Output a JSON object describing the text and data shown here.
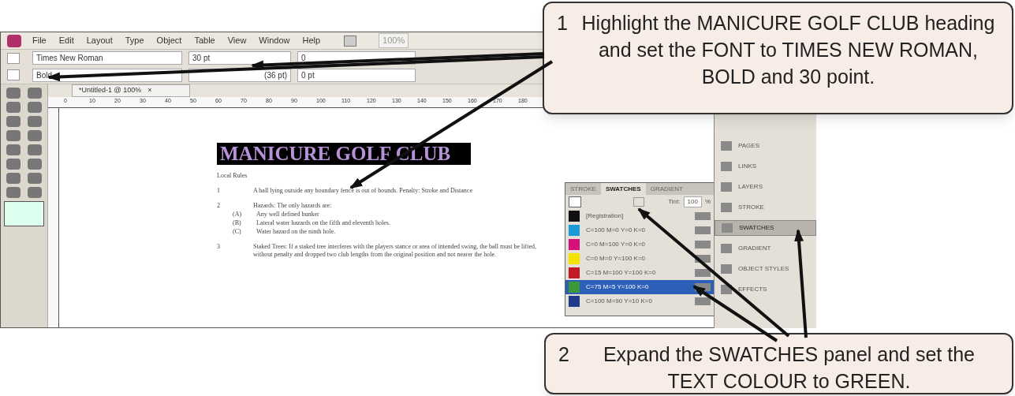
{
  "menu_bar": [
    "File",
    "Edit",
    "Layout",
    "Type",
    "Object",
    "Table",
    "View",
    "Window",
    "Help"
  ],
  "zoom_field": "100%",
  "control_bar": {
    "font_family": "Times New Roman",
    "font_style": "Bold",
    "font_size": "30 pt",
    "leading": "(36 pt)",
    "tracking": "0",
    "baseline": "0 pt"
  },
  "document_tab": {
    "label": "*Untitled-1 @ 100%",
    "close": "×"
  },
  "ruler_marks": [
    "0",
    "10",
    "20",
    "30",
    "40",
    "50",
    "60",
    "70",
    "80",
    "90",
    "100",
    "110",
    "120",
    "130",
    "140",
    "150",
    "160",
    "170",
    "180"
  ],
  "document": {
    "heading": "MANICURE GOLF CLUB",
    "paragraphs": [
      {
        "kind": "plain",
        "text": "Local Rules"
      },
      {
        "kind": "numbered",
        "number": "1",
        "text": "A ball lying outside any boundary fence is out of bounds.  Penalty: Stroke and Distance"
      },
      {
        "kind": "numbered",
        "number": "2",
        "text": "Hazards:  The only hazards are:"
      },
      {
        "kind": "sub",
        "number": "(A)",
        "text": "Any well defined bunker"
      },
      {
        "kind": "sub",
        "number": "(B)",
        "text": "Lateral water hazards on the fifth and eleventh holes."
      },
      {
        "kind": "sub",
        "number": "(C)",
        "text": "Water hazard on the ninth hole."
      },
      {
        "kind": "numbered",
        "number": "3",
        "text": "Staked Trees:  If a staked tree interferes with the players stance or area of intended swing, the ball must be lifted, without penalty and dropped two club lengths from the original position and not nearer the hole."
      }
    ]
  },
  "swatches_panel": {
    "tabs": [
      {
        "label": "STROKE",
        "selected": false
      },
      {
        "label": "SWATCHES",
        "selected": true
      },
      {
        "label": "GRADIENT",
        "selected": false
      }
    ],
    "tint_label": "Tint:",
    "tint_value": "100",
    "tint_unit": "%",
    "swatches": [
      {
        "name": "[Registration]",
        "color": "#111111",
        "selected": false
      },
      {
        "name": "C=100 M=0 Y=0 K=0",
        "color": "#1a9ad6",
        "selected": false
      },
      {
        "name": "C=0 M=100 Y=0 K=0",
        "color": "#d6127a",
        "selected": false
      },
      {
        "name": "C=0 M=0 Y=100 K=0",
        "color": "#f5e400",
        "selected": false
      },
      {
        "name": "C=15 M=100 Y=100 K=0",
        "color": "#c41a24",
        "selected": false
      },
      {
        "name": "C=75 M=5 Y=100 K=0",
        "color": "#3a9a3a",
        "selected": true
      },
      {
        "name": "C=100 M=90 Y=10 K=0",
        "color": "#1e3a8a",
        "selected": false
      }
    ]
  },
  "dock": [
    {
      "label": "PAGES",
      "selected": false
    },
    {
      "label": "LINKS",
      "selected": false
    },
    {
      "label": "LAYERS",
      "selected": false
    },
    {
      "label": "STROKE",
      "selected": false
    },
    {
      "label": "SWATCHES",
      "selected": true
    },
    {
      "label": "GRADIENT",
      "selected": false
    },
    {
      "label": "OBJECT STYLES",
      "selected": false
    },
    {
      "label": "EFFECTS",
      "selected": false
    }
  ],
  "callouts": [
    {
      "number": "1",
      "text": "Highlight the MANICURE GOLF CLUB heading and set the FONT to TIMES NEW ROMAN, BOLD and 30 point."
    },
    {
      "number": "2",
      "text": "Expand the SWATCHES panel and set the TEXT COLOUR to GREEN."
    }
  ]
}
